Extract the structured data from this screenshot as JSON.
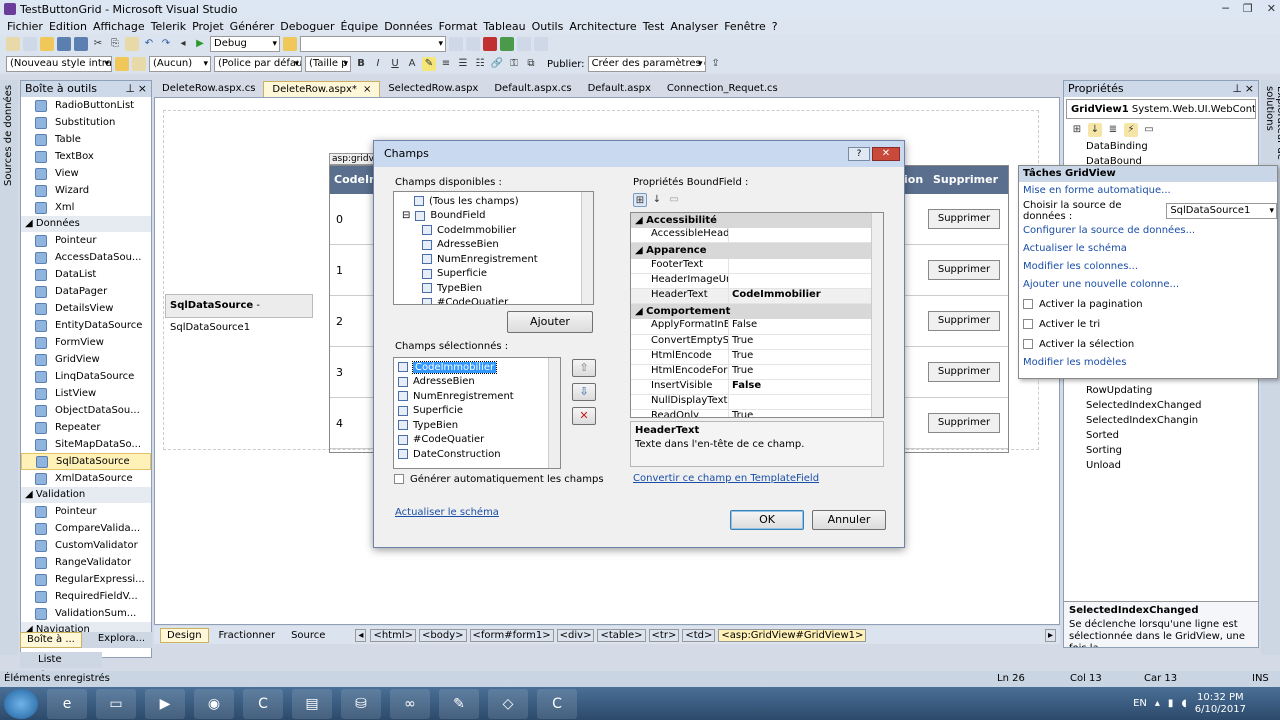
{
  "window": {
    "title": "TestButtonGrid - Microsoft Visual Studio"
  },
  "menu": [
    "Fichier",
    "Edition",
    "Affichage",
    "Telerik",
    "Projet",
    "Générer",
    "Deboguer",
    "Équipe",
    "Données",
    "Format",
    "Tableau",
    "Outils",
    "Architecture",
    "Test",
    "Analyser",
    "Fenêtre",
    "?"
  ],
  "toolbar1": {
    "config": "Debug",
    "search": ""
  },
  "toolbar2": {
    "style": "(Nouveau style intrali",
    "aucun": "(Aucun)",
    "police": "(Police par défaut",
    "taille": "(Taille p",
    "publier_label": "Publier:",
    "publier_value": "Créer des paramètres de"
  },
  "toolbox": {
    "title": "Boîte à outils",
    "side_label": "Sources de données",
    "items_std": [
      "RadioButtonList",
      "Substitution",
      "Table",
      "TextBox",
      "View",
      "Wizard",
      "Xml"
    ],
    "cat_data": "Données",
    "items_data": [
      "Pointeur",
      "AccessDataSou...",
      "DataList",
      "DataPager",
      "DetailsView",
      "EntityDataSource",
      "FormView",
      "GridView",
      "LinqDataSource",
      "ListView",
      "ObjectDataSou...",
      "Repeater",
      "SiteMapDataSo...",
      "SqlDataSource",
      "XmlDataSource"
    ],
    "cat_validation": "Validation",
    "items_validation": [
      "Pointeur",
      "CompareValida...",
      "CustomValidator",
      "RangeValidator",
      "RegularExpressi...",
      "RequiredFieldV...",
      "ValidationSum..."
    ],
    "cat_nav": "Navigation",
    "bottom_tabs": [
      "Boîte à ...",
      "Explora..."
    ]
  },
  "doc_tabs": [
    "DeleteRow.aspx.cs",
    "DeleteRow.aspx*",
    "SelectedRow.aspx",
    "Default.aspx.cs",
    "Default.aspx",
    "Connection_Requet.cs"
  ],
  "designer": {
    "sql_label": "SqlDataSource",
    "sql_name": "- SqlDataSource1",
    "grid_tag": "asp:gridv",
    "grid_header_left": "CodeIm",
    "grid_header_mid": "ion",
    "grid_header_right": "Supprimer",
    "rows": [
      "0",
      "1",
      "2",
      "3",
      "4"
    ],
    "row_button": "Supprimer"
  },
  "view_tabs": {
    "design": "Design",
    "split": "Fractionner",
    "source": "Source"
  },
  "breadcrumb": [
    "<html>",
    "<body>",
    "<form#form1>",
    "<div>",
    "<table>",
    "<tr>",
    "<td>",
    "<asp:GridView#GridView1>"
  ],
  "dialog": {
    "title": "Champs",
    "available_label": "Champs disponibles :",
    "available": [
      "(Tous les champs)",
      "BoundField",
      "CodeImmobilier",
      "AdresseBien",
      "NumEnregistrement",
      "Superficie",
      "TypeBien",
      "#CodeQuatier"
    ],
    "add_button": "Ajouter",
    "selected_label": "Champs sélectionnés :",
    "selected": [
      "CodeImmobilier",
      "AdresseBien",
      "NumEnregistrement",
      "Superficie",
      "TypeBien",
      "#CodeQuatier",
      "DateConstruction"
    ],
    "auto_generate": "Générer automatiquement les champs",
    "refresh_schema": "Actualiser le schéma",
    "props_label": "Propriétés BoundField :",
    "props": [
      {
        "cat": "Accessibilité"
      },
      {
        "k": "AccessibleHeaderText",
        "v": ""
      },
      {
        "cat": "Apparence"
      },
      {
        "k": "FooterText",
        "v": ""
      },
      {
        "k": "HeaderImageUrl",
        "v": ""
      },
      {
        "k": "HeaderText",
        "v": "CodeImmobilier",
        "bold": true
      },
      {
        "cat": "Comportement"
      },
      {
        "k": "ApplyFormatInEditMod",
        "v": "False"
      },
      {
        "k": "ConvertEmptyStringTo",
        "v": "True"
      },
      {
        "k": "HtmlEncode",
        "v": "True"
      },
      {
        "k": "HtmlEncodeFormatStri",
        "v": "True"
      },
      {
        "k": "InsertVisible",
        "v": "False",
        "bold": true
      },
      {
        "k": "NullDisplayText",
        "v": ""
      },
      {
        "k": "ReadOnly",
        "v": "True"
      }
    ],
    "desc_title": "HeaderText",
    "desc_text": "Texte dans l'en-tête de ce champ.",
    "convert_link": "Convertir ce champ en TemplateField",
    "ok": "OK",
    "cancel": "Annuler"
  },
  "properties": {
    "title": "Propriétés",
    "object": "GridView1",
    "object_type": "System.Web.UI.WebControls.G",
    "side_label": "Explorateur de solutions",
    "events_top": [
      "DataBinding",
      "DataBound"
    ],
    "events": [
      "RowUpdating",
      "SelectedIndexChanged",
      "SelectedIndexChangin",
      "Sorted",
      "Sorting",
      "Unload"
    ],
    "desc_title": "SelectedIndexChanged",
    "desc_text": "Se déclenche lorsqu'une ligne est sélectionnée dans le GridView, une fois la ..."
  },
  "tasks": {
    "title": "Tâches GridView",
    "auto_format": "Mise en forme automatique...",
    "source_label": "Choisir la source de données :",
    "source_value": "SqlDataSource1",
    "configure": "Configurer la source de données...",
    "refresh": "Actualiser le schéma",
    "edit_columns": "Modifier les colonnes...",
    "add_column": "Ajouter une nouvelle colonne...",
    "paging": "Activer la pagination",
    "sorting": "Activer le tri",
    "selection": "Activer la sélection",
    "edit_templates": "Modifier les modèles"
  },
  "errors_tab": "Liste d'erreurs",
  "statusbar": {
    "left": "Éléments enregistrés",
    "ln": "Ln 26",
    "col": "Col 13",
    "car": "Car 13",
    "ins": "INS"
  },
  "taskbar": {
    "lang": "EN",
    "time": "10:32 PM",
    "date": "6/10/2017"
  }
}
